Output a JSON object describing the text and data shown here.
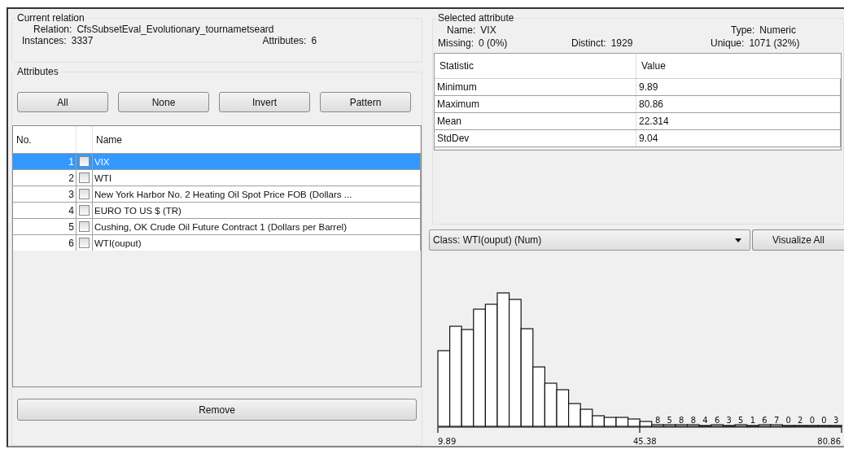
{
  "current_relation": {
    "title": "Current relation",
    "relation_label": "Relation:",
    "relation": "CfsSubsetEval_Evolutionary_tournametseard",
    "instances_label": "Instances:",
    "instances": "3337",
    "attributes_label": "Attributes:",
    "attributes": "6"
  },
  "attributes": {
    "title": "Attributes",
    "buttons": [
      "All",
      "None",
      "Invert",
      "Pattern"
    ],
    "columns": {
      "no": "No.",
      "name": "Name"
    },
    "rows": [
      {
        "no": "1",
        "name": "VIX",
        "checked": false,
        "selected": true
      },
      {
        "no": "2",
        "name": "WTI",
        "checked": false,
        "selected": false
      },
      {
        "no": "3",
        "name": "New York Harbor No. 2 Heating Oil Spot Price FOB (Dollars ...",
        "checked": false,
        "selected": false
      },
      {
        "no": "4",
        "name": "EURO TO US $ (TR)",
        "checked": false,
        "selected": false
      },
      {
        "no": "5",
        "name": "Cushing, OK Crude Oil Future Contract 1 (Dollars per Barrel)",
        "checked": false,
        "selected": false
      },
      {
        "no": "6",
        "name": "WTI(ouput)",
        "checked": false,
        "selected": false
      }
    ],
    "remove_button": "Remove"
  },
  "selected_attribute": {
    "title": "Selected attribute",
    "name_label": "Name:",
    "name": "VIX",
    "type_label": "Type:",
    "type": "Numeric",
    "missing_label": "Missing:",
    "missing": "0 (0%)",
    "distinct_label": "Distinct:",
    "distinct": "1929",
    "unique_label": "Unique:",
    "unique": "1071 (32%)",
    "stats": {
      "columns": [
        "Statistic",
        "Value"
      ],
      "rows": [
        [
          "Minimum",
          "9.89"
        ],
        [
          "Maximum",
          "80.86"
        ],
        [
          "Mean",
          "22.314"
        ],
        [
          "StdDev",
          "9.04"
        ]
      ]
    }
  },
  "class_dropdown": "Class: WTI(ouput) (Num)",
  "visualize_button": "Visualize All",
  "histogram": {
    "count_labels": [
      "8",
      "5",
      "8",
      "8",
      "4",
      "6",
      "3",
      "5",
      "1",
      "6",
      "7",
      "0",
      "2",
      "0",
      "0",
      "3"
    ],
    "axis_labels": [
      "9.89",
      "45.38",
      "80.86"
    ]
  }
}
